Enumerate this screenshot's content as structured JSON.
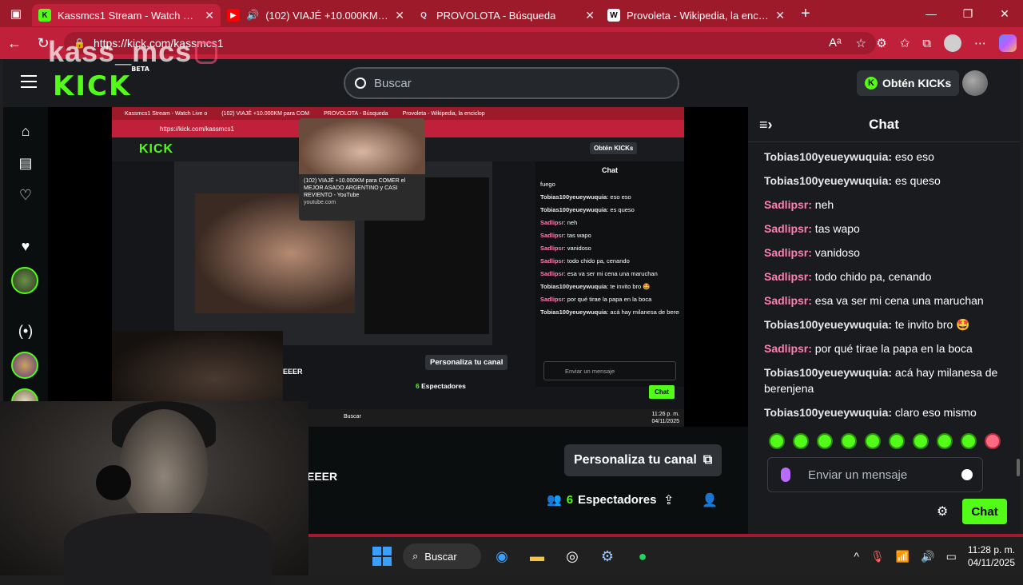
{
  "browser": {
    "tabs": [
      {
        "title": "Kassmcs1 Stream - Watch Live on",
        "favicon": "K",
        "active": true
      },
      {
        "title": "(102) VIAJÉ +10.000KM para",
        "favicon": "▶",
        "active": false
      },
      {
        "title": "PROVOLOTA - Búsqueda",
        "favicon": "Q",
        "active": false
      },
      {
        "title": "Provoleta - Wikipedia, la enciclop",
        "favicon": "W",
        "active": false
      }
    ],
    "url": "https://kick.com/kassmcs1",
    "overlay_name": "kass_mcs"
  },
  "kick": {
    "logo": "KICK",
    "logo_badge": "BETA",
    "search_placeholder": "Buscar",
    "kicks_button": "Obtén KICKs",
    "personaliza": "Personaliza tu canal",
    "spectators_count": "6",
    "spectators_label": "Espectadores",
    "streamer_name_fragment": "EEER"
  },
  "inner_stream": {
    "tabs": [
      "Kassmcs1 Stream - Watch Live o",
      "(102) VIAJÉ +10.000KM para COM",
      "PROVOLOTA - Búsqueda",
      "Provoleta - Wikipedia, la enciclop"
    ],
    "url": "https://kick.com/kassmcs1",
    "logo": "KICK",
    "kicks_button": "Obtén KICKs",
    "popup_text": "(102) VIAJÉ +10.000KM para COMER el MEJOR ASADO ARGENTINO y CASI REVIENTO - YouTube",
    "popup_domain": "youtube.com",
    "chat_title": "Chat",
    "chat_lines": [
      {
        "user": "",
        "text": "fuego"
      },
      {
        "user": "Tobias100yeueywuquia",
        "text": ": eso eso"
      },
      {
        "user": "Tobias100yeueywuquia",
        "text": ": es queso"
      },
      {
        "user": "Sadlipsr",
        "text": ": neh"
      },
      {
        "user": "Sadlipsr",
        "text": ": tas wapo"
      },
      {
        "user": "Sadlipsr",
        "text": ": vanidoso"
      },
      {
        "user": "Sadlipsr",
        "text": ": todo chido pa, cenando"
      },
      {
        "user": "Sadlipsr",
        "text": ": esa va ser mi cena una maruchan"
      },
      {
        "user": "Tobias100yeueywuquia",
        "text": ": te invito bro 🤩"
      },
      {
        "user": "Sadlipsr",
        "text": ": por qué tirae la papa en la boca"
      },
      {
        "user": "Tobias100yeueywuquia",
        "text": ": acá hay milanesa de berenjena"
      }
    ],
    "chat_placeholder": "Enviar un mensaje",
    "chat_button": "Chat",
    "personaliza": "Personaliza tu canal",
    "spectators_count": "6",
    "spectators_label": "Espectadores",
    "streamer_name_fragment": "EEER",
    "taskbar_search": "Buscar",
    "clock_time": "11:26 p. m.",
    "clock_date": "04/11/2025"
  },
  "chat": {
    "title": "Chat",
    "messages": [
      {
        "user": "Tobias100yeueywuquia",
        "text": " eso eso",
        "color": "green"
      },
      {
        "user": "Tobias100yeueywuquia",
        "text": " es queso",
        "color": "green"
      },
      {
        "user": "Sadlipsr",
        "text": " neh",
        "color": "pink"
      },
      {
        "user": "Sadlipsr",
        "text": " tas wapo",
        "color": "pink"
      },
      {
        "user": "Sadlipsr",
        "text": " vanidoso",
        "color": "pink"
      },
      {
        "user": "Sadlipsr",
        "text": " todo chido pa, cenando",
        "color": "pink"
      },
      {
        "user": "Sadlipsr",
        "text": " esa va ser mi cena una maruchan",
        "color": "pink"
      },
      {
        "user": "Tobias100yeueywuquia",
        "text": " te invito bro 🤩",
        "color": "green"
      },
      {
        "user": "Sadlipsr",
        "text": " por qué tirae la papa en la boca",
        "color": "pink"
      },
      {
        "user": "Tobias100yeueywuquia",
        "text": " acá hay milanesa de berenjena",
        "color": "green"
      },
      {
        "user": "Tobias100yeueywuquia",
        "text": " claro eso mismo",
        "color": "green"
      }
    ],
    "input_placeholder": "Enviar un mensaje",
    "send_label": "Chat"
  },
  "taskbar": {
    "search_label": "Buscar",
    "time": "11:28 p. m.",
    "date": "04/11/2025"
  },
  "colors": {
    "kick_green": "#53fc18",
    "browser_red": "#c0203a",
    "pink_user": "#ff80b5"
  }
}
